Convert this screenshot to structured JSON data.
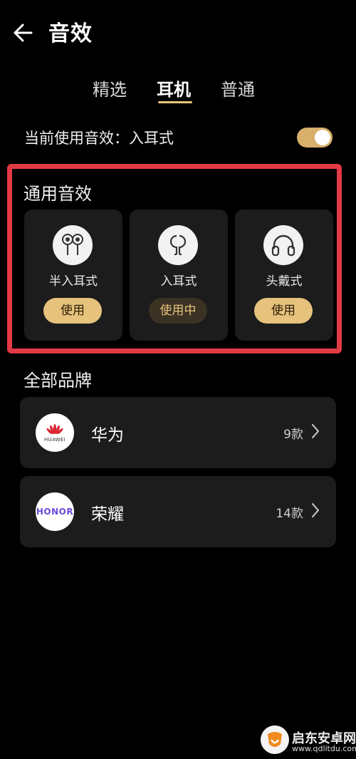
{
  "header": {
    "title": "音效"
  },
  "tabs": [
    {
      "label": "精选",
      "active": false
    },
    {
      "label": "耳机",
      "active": true
    },
    {
      "label": "普通",
      "active": false
    }
  ],
  "current_effect": {
    "text": "当前使用音效：入耳式",
    "toggle_on": true
  },
  "general": {
    "title": "通用音效",
    "cards": [
      {
        "label": "半入耳式",
        "button": "使用",
        "icon": "semi-in-ear-earbuds-icon"
      },
      {
        "label": "入耳式",
        "button": "使用中",
        "icon": "in-ear-earbuds-icon"
      },
      {
        "label": "头戴式",
        "button": "使用",
        "icon": "headphones-icon"
      }
    ]
  },
  "brands": {
    "title": "全部品牌",
    "items": [
      {
        "name": "华为",
        "count": "9款",
        "logo_text": "HUAWEI"
      },
      {
        "name": "荣耀",
        "count": "14款",
        "logo_text": "HONOR"
      }
    ]
  },
  "watermark": {
    "cn": "启东安卓网",
    "url": "www.qdlitdu.com"
  },
  "colors": {
    "accent": "#e6c27d",
    "highlight": "#e23a45",
    "card": "#1c1c1c",
    "background": "#000000"
  }
}
